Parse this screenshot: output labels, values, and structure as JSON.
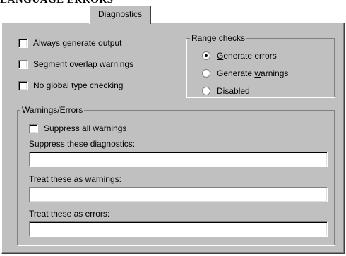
{
  "window": {
    "clipped_title": "LANGUAGE ERRORS"
  },
  "tabs": [
    {
      "label": "Diagnostics"
    }
  ],
  "general": {
    "always_generate_output": {
      "label": "Always generate output",
      "checked": false
    },
    "segment_overlap_warnings": {
      "label": "Segment overlap warnings",
      "checked": false
    },
    "no_global_type_checking": {
      "label": "No global type checking",
      "checked": false
    }
  },
  "range_checks": {
    "title": "Range checks",
    "options": [
      {
        "label": "Generate errors",
        "mnemonic": "G",
        "selected": true
      },
      {
        "label": "Generate warnings",
        "mnemonic": "w",
        "selected": false
      },
      {
        "label": "Disabled",
        "mnemonic": "s",
        "selected": false
      }
    ]
  },
  "warnings_errors": {
    "title": "Warnings/Errors",
    "suppress_all": {
      "label": "Suppress all warnings",
      "checked": false
    },
    "suppress_diagnostics": {
      "label": "Suppress these diagnostics:",
      "value": ""
    },
    "treat_as_warnings": {
      "label": "Treat these as warnings:",
      "value": ""
    },
    "treat_as_errors": {
      "label": "Treat these as errors:",
      "value": ""
    }
  }
}
